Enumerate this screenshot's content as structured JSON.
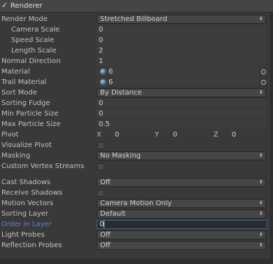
{
  "header": {
    "check": "✓",
    "title": "Renderer"
  },
  "rows": {
    "render_mode": {
      "label": "Render Mode",
      "value": "Stretched Billboard"
    },
    "camera_scale": {
      "label": "Camera Scale",
      "value": "0"
    },
    "speed_scale": {
      "label": "Speed Scale",
      "value": "0"
    },
    "length_scale": {
      "label": "Length Scale",
      "value": "2"
    },
    "normal_direction": {
      "label": "Normal Direction",
      "value": "1"
    },
    "material": {
      "label": "Material",
      "value": "6"
    },
    "trail_material": {
      "label": "Trail Material",
      "value": "6"
    },
    "sort_mode": {
      "label": "Sort Mode",
      "value": "By Distance"
    },
    "sorting_fudge": {
      "label": "Sorting Fudge",
      "value": "0"
    },
    "min_particle_size": {
      "label": "Min Particle Size",
      "value": "0"
    },
    "max_particle_size": {
      "label": "Max Particle Size",
      "value": "0.5"
    },
    "pivot": {
      "label": "Pivot",
      "x_label": "X",
      "x": "0",
      "y_label": "Y",
      "y": "0",
      "z_label": "Z",
      "z": "0"
    },
    "visualize_pivot": {
      "label": "Visualize Pivot",
      "checked": false
    },
    "masking": {
      "label": "Masking",
      "value": "No Masking"
    },
    "custom_vertex_streams": {
      "label": "Custom Vertex Streams",
      "checked": false
    },
    "cast_shadows": {
      "label": "Cast Shadows",
      "value": "Off"
    },
    "receive_shadows": {
      "label": "Receive Shadows",
      "checked": false
    },
    "motion_vectors": {
      "label": "Motion Vectors",
      "value": "Camera Motion Only"
    },
    "sorting_layer": {
      "label": "Sorting Layer",
      "value": "Default"
    },
    "order_in_layer": {
      "label": "Order in Layer",
      "value": "0"
    },
    "light_probes": {
      "label": "Light Probes",
      "value": "Off"
    },
    "reflection_probes": {
      "label": "Reflection Probes",
      "value": "Off"
    }
  },
  "icons": {
    "dropdown_arrow": "⬍"
  }
}
